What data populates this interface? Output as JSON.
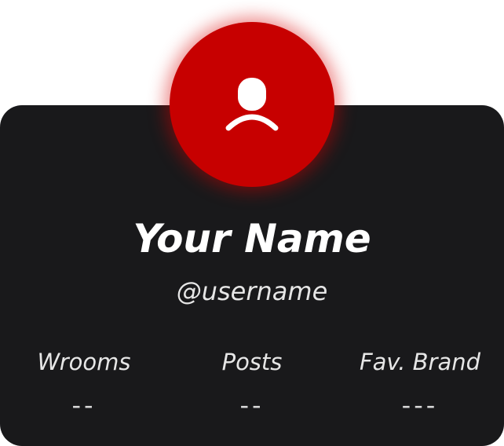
{
  "profile": {
    "name": "Your Name",
    "username": "@username",
    "avatar_icon": "user-placeholder-icon",
    "accent_color": "#c70000",
    "card_color": "#19191b"
  },
  "stats": [
    {
      "label": "Wrooms",
      "value": "--"
    },
    {
      "label": "Posts",
      "value": "--"
    },
    {
      "label": "Fav. Brand",
      "value": "---"
    }
  ]
}
